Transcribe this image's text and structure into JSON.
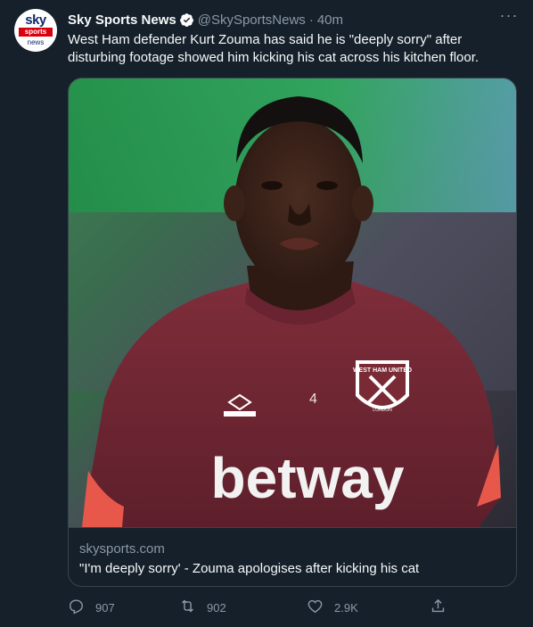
{
  "tweet": {
    "display_name": "Sky Sports News",
    "handle": "@SkySportsNews",
    "separator": "·",
    "time": "40m",
    "more": "···",
    "text": "West Ham defender Kurt Zouma has said he is \"deeply sorry\" after disturbing footage showed him kicking his cat across his kitchen floor.",
    "avatar": {
      "line1": "sky",
      "line2": "sports",
      "line3": "news"
    }
  },
  "card": {
    "domain": "skysports.com",
    "title": "\"I'm deeply sorry' - Zouma apologises after kicking his cat",
    "image": {
      "shirt_sponsor": "betway",
      "shirt_number": "4",
      "crest_text_top": "WEST HAM UNITED",
      "crest_text_bottom": "LONDON",
      "kit_brand": "umbro"
    }
  },
  "actions": {
    "reply_count": "907",
    "retweet_count": "902",
    "like_count": "2.9K"
  },
  "colors": {
    "background": "#15202b",
    "secondary_text": "#8b98a5",
    "border": "#38444d",
    "verified": "#ffffff",
    "shirt": "#7a2a35"
  },
  "icons": [
    "verified-badge-icon",
    "more-icon",
    "reply-icon",
    "retweet-icon",
    "like-icon",
    "share-icon"
  ]
}
